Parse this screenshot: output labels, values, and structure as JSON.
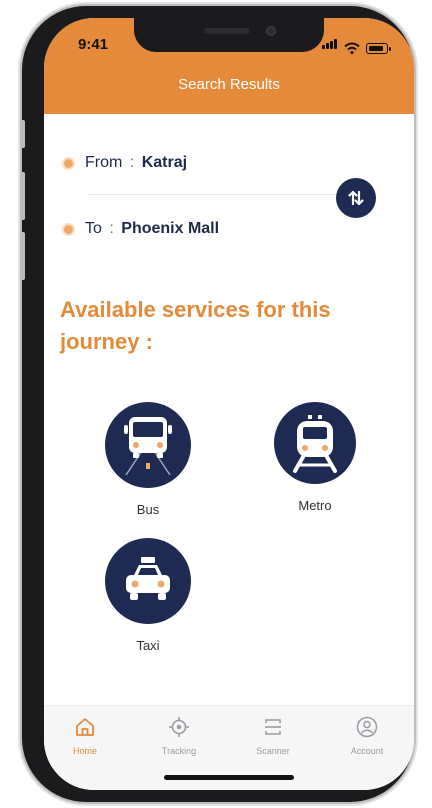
{
  "status": {
    "time": "9:41"
  },
  "header": {
    "title": "Search Results"
  },
  "route": {
    "from": {
      "label": "From",
      "separator": ":",
      "value": "Katraj"
    },
    "to": {
      "label": "To",
      "separator": ":",
      "value": "Phoenix Mall"
    },
    "swap_icon": "swap-vertical-icon"
  },
  "services": {
    "title": "Available services for this journey :",
    "items": [
      {
        "name": "Bus",
        "icon": "bus-icon"
      },
      {
        "name": "Metro",
        "icon": "metro-icon"
      },
      {
        "name": "Taxi",
        "icon": "taxi-icon"
      }
    ]
  },
  "tabbar": {
    "items": [
      {
        "label": "Home",
        "icon": "home-icon",
        "active": true
      },
      {
        "label": "Tracking",
        "icon": "tracking-icon",
        "active": false
      },
      {
        "label": "Scanner",
        "icon": "scanner-icon",
        "active": false
      },
      {
        "label": "Account",
        "icon": "account-icon",
        "active": false
      }
    ]
  },
  "colors": {
    "accent": "#e58a3a",
    "navy": "#1f2a52",
    "text": "#1e2a4a"
  }
}
